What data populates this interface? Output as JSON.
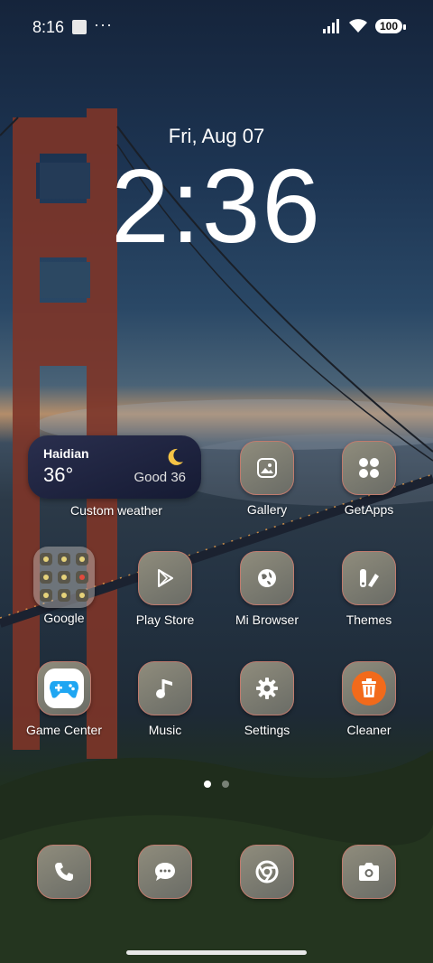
{
  "status_bar": {
    "time": "8:16",
    "more": "···",
    "battery": "100"
  },
  "lockscreen": {
    "date": "Fri, Aug 07",
    "clock": "2:36"
  },
  "weather_widget": {
    "city": "Haidian",
    "temperature": "36°",
    "air_quality": "Good 36",
    "label": "Custom weather"
  },
  "apps": {
    "gallery": "Gallery",
    "getapps": "GetApps",
    "google": "Google",
    "playstore": "Play Store",
    "browser": "Mi Browser",
    "themes": "Themes",
    "gamecenter": "Game Center",
    "music": "Music",
    "settings": "Settings",
    "cleaner": "Cleaner"
  },
  "dock": [
    "Phone",
    "Messages",
    "Chrome",
    "Camera"
  ],
  "page_indicator": {
    "pages": 2,
    "current": 1
  },
  "colors": {
    "icon_border": "#c07b6e",
    "cleaner_orange": "#f26a1b",
    "game_blue": "#1fa6f2"
  }
}
